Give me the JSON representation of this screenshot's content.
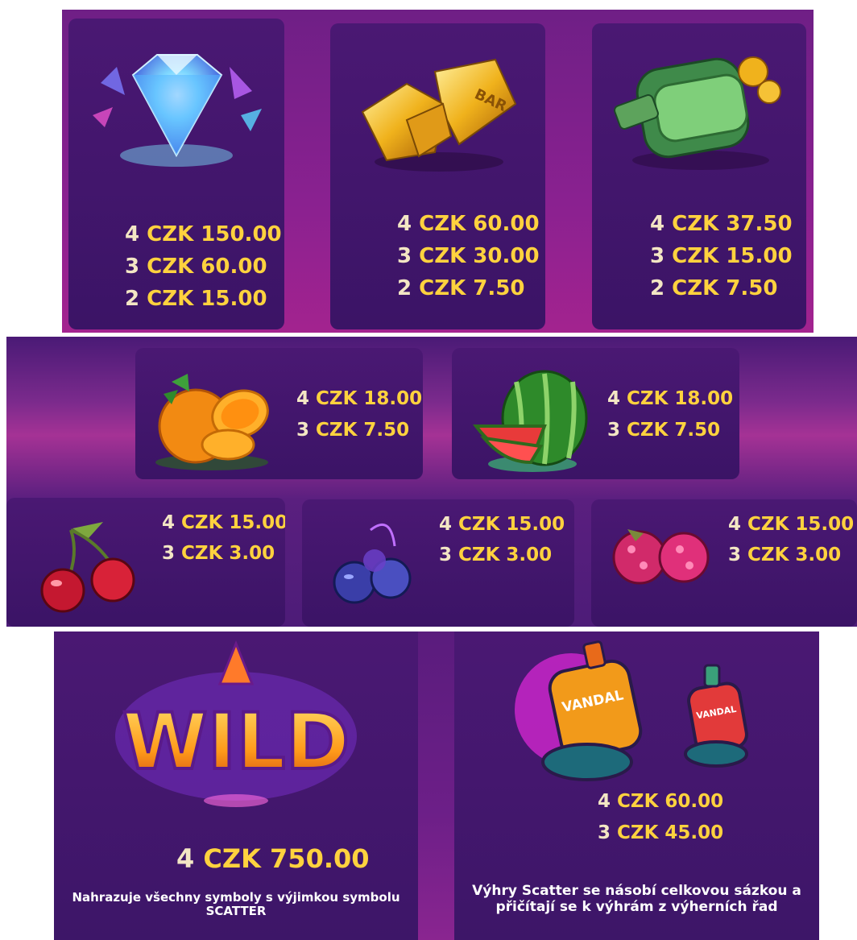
{
  "top_row": [
    {
      "symbol": "diamond-icon",
      "lines": [
        {
          "count": "4",
          "amount": "CZK 150.00"
        },
        {
          "count": "3",
          "amount": "CZK 60.00"
        },
        {
          "count": "2",
          "amount": "CZK 15.00"
        }
      ]
    },
    {
      "symbol": "gold-bar-icon",
      "label": "BAR",
      "lines": [
        {
          "count": "4",
          "amount": "CZK 60.00"
        },
        {
          "count": "3",
          "amount": "CZK 30.00"
        },
        {
          "count": "2",
          "amount": "CZK 7.50"
        }
      ]
    },
    {
      "symbol": "money-bundle-icon",
      "lines": [
        {
          "count": "4",
          "amount": "CZK 37.50"
        },
        {
          "count": "3",
          "amount": "CZK 15.00"
        },
        {
          "count": "2",
          "amount": "CZK 7.50"
        }
      ]
    }
  ],
  "middle_row": [
    {
      "symbol": "orange-icon",
      "lines": [
        {
          "count": "4",
          "amount": "CZK 18.00"
        },
        {
          "count": "3",
          "amount": "CZK 7.50"
        }
      ]
    },
    {
      "symbol": "watermelon-icon",
      "lines": [
        {
          "count": "4",
          "amount": "CZK 18.00"
        },
        {
          "count": "3",
          "amount": "CZK 7.50"
        }
      ]
    }
  ],
  "lower_row": [
    {
      "symbol": "cherry-icon",
      "lines": [
        {
          "count": "4",
          "amount": "CZK 15.00"
        },
        {
          "count": "3",
          "amount": "CZK 3.00"
        }
      ]
    },
    {
      "symbol": "blueberry-icon",
      "lines": [
        {
          "count": "4",
          "amount": "CZK 15.00"
        },
        {
          "count": "3",
          "amount": "CZK 3.00"
        }
      ]
    },
    {
      "symbol": "raspberry-icon",
      "lines": [
        {
          "count": "4",
          "amount": "CZK 15.00"
        },
        {
          "count": "3",
          "amount": "CZK 3.00"
        }
      ]
    }
  ],
  "wild": {
    "symbol": "wild-icon",
    "logo_text": "WILD",
    "lines": [
      {
        "count": "4",
        "amount": "CZK 750.00"
      }
    ],
    "description": "Nahrazuje všechny symboly s výjimkou symbolu SCATTER"
  },
  "scatter": {
    "symbol": "spray-can-icon",
    "can_label": "VANDAL",
    "lines": [
      {
        "count": "4",
        "amount": "CZK 60.00"
      },
      {
        "count": "3",
        "amount": "CZK 45.00"
      }
    ],
    "description_line1": "Výhry Scatter se násobí celkovou sázkou a",
    "description_line2": "přičítají se k výhrám z výherních řad"
  }
}
